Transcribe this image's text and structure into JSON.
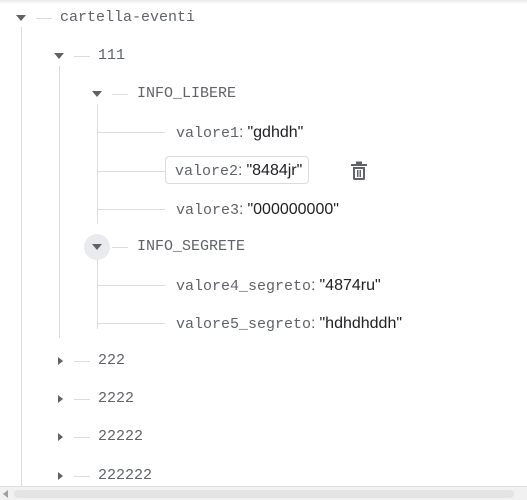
{
  "tree": {
    "root": {
      "key": "cartella-eventi",
      "expanded": true,
      "children": [
        {
          "key": "111",
          "expanded": true,
          "groups": [
            {
              "key": "INFO_LIBERE",
              "expanded": true,
              "fields": [
                {
                  "key": "valore1",
                  "value": "\"gdhdh\""
                },
                {
                  "key": "valore2",
                  "value": "\"8484jr\"",
                  "selected": true
                },
                {
                  "key": "valore3",
                  "value": "\"000000000\""
                }
              ]
            },
            {
              "key": "INFO_SEGRETE",
              "expanded": true,
              "fields": [
                {
                  "key": "valore4_segreto",
                  "value": "\"4874ru\""
                },
                {
                  "key": "valore5_segreto",
                  "value": "\"hdhdhddh\""
                }
              ]
            }
          ]
        },
        {
          "key": "222",
          "expanded": false
        },
        {
          "key": "2222",
          "expanded": false
        },
        {
          "key": "22222",
          "expanded": false
        },
        {
          "key": "222222",
          "expanded": false
        }
      ]
    },
    "colon": ":",
    "delete_icon": "trash-icon"
  },
  "colors": {
    "key_text": "#5f6368",
    "value_text": "#202124",
    "tree_line": "#dadce0",
    "toggle_hover": "#e8eaed"
  }
}
